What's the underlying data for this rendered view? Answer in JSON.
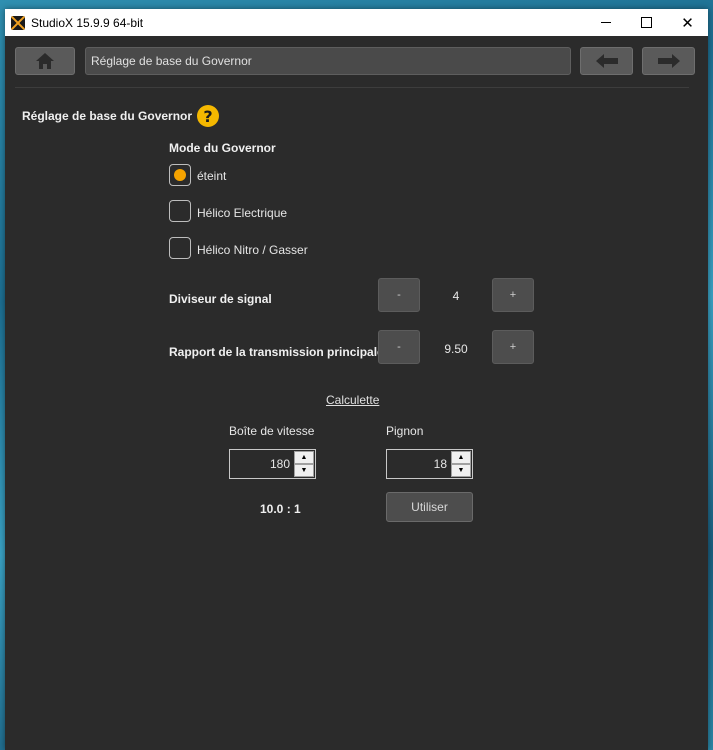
{
  "window": {
    "title": "StudioX 15.9.9  64-bit"
  },
  "nav": {
    "breadcrumb": "Réglage de base du Governor"
  },
  "section": {
    "title": "Réglage de base du Governor",
    "help_glyph": "?"
  },
  "governor_mode": {
    "heading": "Mode du Governor",
    "options": [
      {
        "label": "éteint",
        "selected": true
      },
      {
        "label": "Hélico Electrique",
        "selected": false
      },
      {
        "label": "Hélico Nitro / Gasser",
        "selected": false
      }
    ]
  },
  "signal_divider": {
    "label": "Diviseur de signal",
    "value": "4",
    "minus": "-",
    "plus": "+"
  },
  "main_gear_ratio": {
    "label": "Rapport de la transmission principale",
    "value": "9.50",
    "minus": "-",
    "plus": "+"
  },
  "calculator": {
    "title": "Calculette",
    "gearbox_label": "Boîte de vitesse",
    "gearbox_value": "180",
    "pinion_label": "Pignon",
    "pinion_value": "18",
    "result": "10.0 : 1",
    "use_button": "Utiliser"
  },
  "colors": {
    "accent": "#f5a300",
    "help": "#f5b800",
    "background": "#2b2b2b"
  }
}
